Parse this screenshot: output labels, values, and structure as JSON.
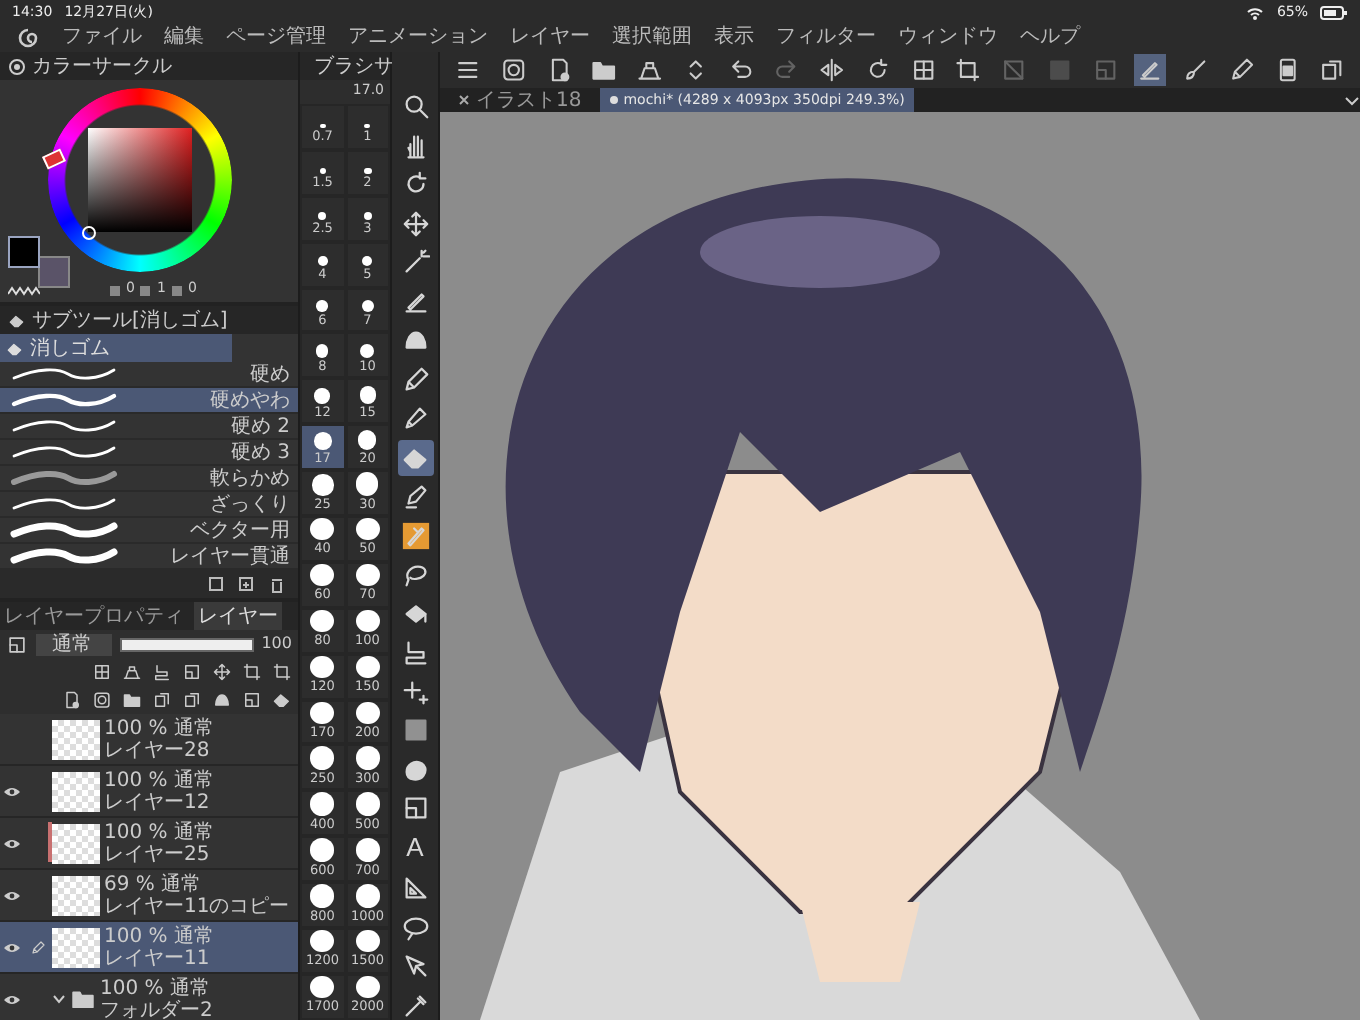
{
  "status_bar": {
    "time": "14:30",
    "date": "12月27日(火)",
    "battery": "65%"
  },
  "menu": [
    "ファイル",
    "編集",
    "ページ管理",
    "アニメーション",
    "レイヤー",
    "選択範囲",
    "表示",
    "フィルター",
    "ウィンドウ",
    "ヘルプ"
  ],
  "toolbar": [
    {
      "kind": "menu",
      "selected": false,
      "disabled": false
    },
    {
      "kind": "app",
      "selected": false,
      "disabled": false
    },
    {
      "kind": "new",
      "selected": false,
      "disabled": false
    },
    {
      "kind": "open",
      "selected": false,
      "disabled": false
    },
    {
      "kind": "save",
      "selected": false,
      "disabled": false
    },
    {
      "kind": "stepper",
      "selected": false,
      "disabled": false
    },
    {
      "kind": "undo",
      "selected": false,
      "disabled": false
    },
    {
      "kind": "redo",
      "selected": false,
      "disabled": true
    },
    {
      "kind": "flip",
      "selected": false,
      "disabled": false
    },
    {
      "kind": "rotate",
      "selected": false,
      "disabled": false
    },
    {
      "kind": "grid",
      "selected": false,
      "disabled": false
    },
    {
      "kind": "crop",
      "selected": false,
      "disabled": false
    },
    {
      "kind": "clear",
      "selected": false,
      "disabled": true
    },
    {
      "kind": "gradient",
      "selected": false,
      "disabled": true
    },
    {
      "kind": "frame",
      "selected": false,
      "disabled": true
    },
    {
      "kind": "selpen",
      "selected": true,
      "disabled": false
    },
    {
      "kind": "brush",
      "selected": false,
      "disabled": false
    },
    {
      "kind": "pen",
      "selected": false,
      "disabled": false
    },
    {
      "kind": "phone",
      "selected": false,
      "disabled": false
    },
    {
      "kind": "transfer",
      "selected": false,
      "disabled": false
    }
  ],
  "color_panel": {
    "title": "カラーサークル",
    "values": [
      "0",
      "1",
      "0"
    ]
  },
  "subtool_panel": {
    "title": "サブツール[消しゴム]",
    "group": "消しゴム",
    "items": [
      {
        "name": "硬め",
        "selected": false
      },
      {
        "name": "硬めやわ",
        "selected": true
      },
      {
        "name": "硬め 2",
        "selected": false
      },
      {
        "name": "硬め 3",
        "selected": false
      },
      {
        "name": "軟らかめ",
        "selected": false
      },
      {
        "name": "ざっくり",
        "selected": false
      },
      {
        "name": "ベクター用",
        "selected": false
      },
      {
        "name": "レイヤー貫通",
        "selected": false
      }
    ]
  },
  "brush_size_panel": {
    "title": "ブラシサ",
    "value": "17.0",
    "sizes": [
      {
        "label": "0.7",
        "selected": false
      },
      {
        "label": "1",
        "selected": false
      },
      {
        "label": "1.5",
        "selected": false
      },
      {
        "label": "2",
        "selected": false
      },
      {
        "label": "2.5",
        "selected": false
      },
      {
        "label": "3",
        "selected": false
      },
      {
        "label": "4",
        "selected": false
      },
      {
        "label": "5",
        "selected": false
      },
      {
        "label": "6",
        "selected": false
      },
      {
        "label": "7",
        "selected": false
      },
      {
        "label": "8",
        "selected": false
      },
      {
        "label": "10",
        "selected": false
      },
      {
        "label": "12",
        "selected": false
      },
      {
        "label": "15",
        "selected": false
      },
      {
        "label": "17",
        "selected": true
      },
      {
        "label": "20",
        "selected": false
      },
      {
        "label": "25",
        "selected": false
      },
      {
        "label": "30",
        "selected": false
      },
      {
        "label": "40",
        "selected": false
      },
      {
        "label": "50",
        "selected": false
      },
      {
        "label": "60",
        "selected": false
      },
      {
        "label": "70",
        "selected": false
      },
      {
        "label": "80",
        "selected": false
      },
      {
        "label": "100",
        "selected": false
      },
      {
        "label": "120",
        "selected": false
      },
      {
        "label": "150",
        "selected": false
      },
      {
        "label": "170",
        "selected": false
      },
      {
        "label": "200",
        "selected": false
      },
      {
        "label": "250",
        "selected": false
      },
      {
        "label": "300",
        "selected": false
      },
      {
        "label": "400",
        "selected": false
      },
      {
        "label": "500",
        "selected": false
      },
      {
        "label": "600",
        "selected": false
      },
      {
        "label": "700",
        "selected": false
      },
      {
        "label": "800",
        "selected": false
      },
      {
        "label": "1000",
        "selected": false
      },
      {
        "label": "1200",
        "selected": false
      },
      {
        "label": "1500",
        "selected": false
      },
      {
        "label": "1700",
        "selected": false
      },
      {
        "label": "2000",
        "selected": false
      }
    ]
  },
  "tools": [
    {
      "kind": "search",
      "selected": false
    },
    {
      "kind": "hand",
      "selected": false
    },
    {
      "kind": "rotate",
      "selected": false
    },
    {
      "kind": "move",
      "selected": false
    },
    {
      "kind": "wand",
      "selected": false
    },
    {
      "kind": "selpen",
      "selected": false
    },
    {
      "kind": "blob",
      "selected": false
    },
    {
      "kind": "pen",
      "selected": false
    },
    {
      "kind": "pencil",
      "selected": false
    },
    {
      "kind": "eraser",
      "selected": true
    },
    {
      "kind": "marker",
      "selected": false
    },
    {
      "kind": "deco",
      "selected": false
    },
    {
      "kind": "lasso",
      "selected": false
    },
    {
      "kind": "bucket",
      "selected": false
    },
    {
      "kind": "stamp",
      "selected": false
    },
    {
      "kind": "sparkle",
      "selected": false
    },
    {
      "kind": "gradient",
      "selected": false
    },
    {
      "kind": "figure",
      "selected": false
    },
    {
      "kind": "frame",
      "selected": false
    },
    {
      "kind": "text",
      "label": "A",
      "selected": false
    },
    {
      "kind": "ruler",
      "selected": false
    },
    {
      "kind": "balloon",
      "selected": false
    },
    {
      "kind": "cursor",
      "selected": false
    },
    {
      "kind": "dropper",
      "selected": false
    }
  ],
  "layer_panel": {
    "tabs": [
      {
        "label": "レイヤープロパティ",
        "selected": false
      },
      {
        "label": "レイヤー",
        "selected": true
      }
    ],
    "blend_mode": "通常",
    "opacity": {
      "value": "100",
      "level": 1
    },
    "layers": [
      {
        "kind": "layer",
        "info": "100 % 通常",
        "name": "レイヤー28",
        "visible": false,
        "selected": false
      },
      {
        "kind": "layer",
        "info": "100 % 通常",
        "name": "レイヤー12",
        "visible": true,
        "selected": false
      },
      {
        "kind": "layer",
        "info": "100 % 通常",
        "name": "レイヤー25",
        "visible": true,
        "selected": false,
        "color": "#c87070"
      },
      {
        "kind": "layer",
        "info": "69 % 通常",
        "name": "レイヤー11のコピー",
        "visible": true,
        "selected": false
      },
      {
        "kind": "layer",
        "info": "100 % 通常",
        "name": "レイヤー11",
        "visible": true,
        "selected": true
      },
      {
        "kind": "folder",
        "info": "100 % 通常",
        "name": "フォルダー2",
        "visible": true,
        "selected": false,
        "expanded": true
      }
    ]
  },
  "canvas": {
    "tabs": [
      {
        "label": "イラスト18",
        "selected": false
      },
      {
        "label": "mochi* (4289 x 4093px 350dpi 249.3%)",
        "selected": true
      }
    ]
  }
}
